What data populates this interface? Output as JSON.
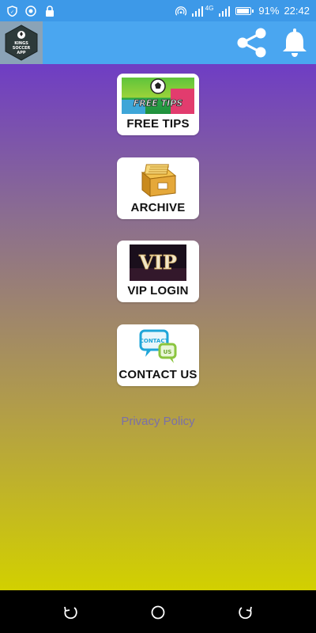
{
  "status_bar": {
    "network_label": "4G",
    "battery_percent": "91%",
    "battery_level": 0.91,
    "time": "22:42",
    "icons": [
      "shield-icon",
      "target-icon",
      "lock-icon",
      "hotspot-icon",
      "signal-icon",
      "signal-icon",
      "battery-icon"
    ]
  },
  "app_bar": {
    "logo_text_line1": "KINGS",
    "logo_text_line2": "SOCCER",
    "logo_text_line3": "APP",
    "icons": [
      "share-icon",
      "bell-icon"
    ],
    "accent": "#4aa6f0"
  },
  "menu": {
    "items": [
      {
        "label": "FREE TIPS",
        "image_text": "FREE TIPS",
        "icon": "free-tips-image"
      },
      {
        "label": "ARCHIVE",
        "icon": "archive-box-image"
      },
      {
        "label": "VIP LOGIN",
        "image_text": "VIP",
        "icon": "vip-image"
      },
      {
        "label": "CONTACT US",
        "image_text_1": "CONTACT",
        "image_text_2": "US",
        "icon": "contact-us-image"
      }
    ]
  },
  "footer": {
    "privacy_label": "Privacy Policy"
  },
  "nav_bar": {
    "icons": [
      "back-icon",
      "home-icon",
      "recents-icon"
    ]
  }
}
